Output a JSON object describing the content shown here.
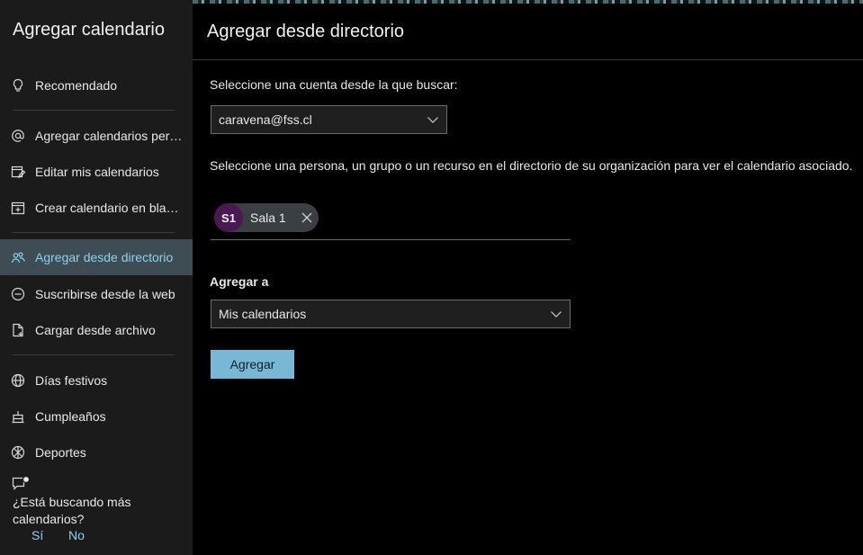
{
  "sidebar": {
    "title": "Agregar calendario",
    "items": [
      {
        "label": "Recomendado",
        "icon": "lightbulb-icon"
      },
      {
        "label": "Agregar calendarios personales",
        "icon": "at-icon"
      },
      {
        "label": "Editar mis calendarios",
        "icon": "edit-calendar-icon"
      },
      {
        "label": "Crear calendario en blanco",
        "icon": "add-calendar-icon"
      },
      {
        "label": "Agregar desde directorio",
        "icon": "people-icon",
        "active": true
      },
      {
        "label": "Suscribirse desde la web",
        "icon": "link-icon"
      },
      {
        "label": "Cargar desde archivo",
        "icon": "file-upload-icon"
      },
      {
        "label": "Días festivos",
        "icon": "globe-icon"
      },
      {
        "label": "Cumpleaños",
        "icon": "cake-icon"
      },
      {
        "label": "Deportes",
        "icon": "sports-icon"
      }
    ],
    "feedback": {
      "question": "¿Está buscando más calendarios?",
      "yes": "Sí",
      "no": "No"
    }
  },
  "main": {
    "title": "Agregar desde directorio",
    "account_label": "Seleccione una cuenta desde la que buscar:",
    "account_value": "caravena@fss.cl",
    "directory_label": "Seleccione una persona, un grupo o un recurso en el directorio de su organización para ver el calendario asociado.",
    "chip": {
      "initials": "S1",
      "name": "Sala 1"
    },
    "add_to_label": "Agregar a",
    "add_to_value": "Mis calendarios",
    "submit_label": "Agregar"
  },
  "colors": {
    "accent": "#8ed1ef",
    "active_bg": "#3e4c54",
    "button_bg": "#78b8d4",
    "avatar_bg": "#4a1952"
  }
}
